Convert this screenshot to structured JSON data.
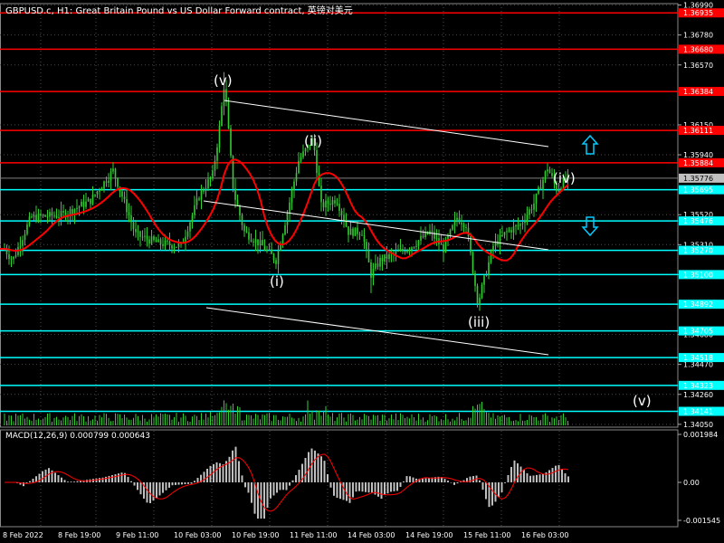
{
  "header": {
    "title": "GBPUSD.c, H1:  Great Britain Pound vs US Dollar Forward contract, 英镑对美元"
  },
  "macd": {
    "label": "MACD(12,26,9) 0.000799 0.000643",
    "axis_labels": [
      "0.001984",
      "0.00",
      "-0.001545"
    ]
  },
  "colors": {
    "background": "#000000",
    "grid": "#4a4a4a",
    "candle": "#33cc33",
    "volume": "#33cc33",
    "resistance": "#ff0000",
    "support": "#00ffff",
    "moving_average": "#ff0000",
    "trendline": "#ffffff",
    "current_price": "#808080",
    "macd_hist": "#c0c0c0",
    "macd_signal": "#ff0000",
    "arrow_up": "#00ccff",
    "arrow_down": "#00ccff"
  },
  "price_axis": {
    "ticks": [
      "1.36990",
      "1.36780",
      "1.36570",
      "1.36150",
      "1.35940",
      "1.35520",
      "1.35310",
      "1.35100",
      "1.34680",
      "1.34470",
      "1.34260",
      "1.34050"
    ]
  },
  "resistance_levels": [
    {
      "price": "1.36935"
    },
    {
      "price": "1.36680"
    },
    {
      "price": "1.36384"
    },
    {
      "price": "1.36111"
    },
    {
      "price": "1.35884"
    }
  ],
  "current_price": "1.35776",
  "support_levels": [
    {
      "price": "1.35695"
    },
    {
      "price": "1.35476"
    },
    {
      "price": "1.35270"
    },
    {
      "price": "1.35100"
    },
    {
      "price": "1.34892"
    },
    {
      "price": "1.34705"
    },
    {
      "price": "1.34518"
    },
    {
      "price": "1.34323"
    },
    {
      "price": "1.34141"
    }
  ],
  "wave_labels": [
    "(v)",
    "(ii)",
    "(i)",
    "(iii)",
    "(iv)",
    "(v)"
  ],
  "time_axis": [
    "8 Feb 2022",
    "8 Feb 19:00",
    "9 Feb 11:00",
    "10 Feb 03:00",
    "10 Feb 19:00",
    "11 Feb 11:00",
    "14 Feb 03:00",
    "14 Feb 19:00",
    "15 Feb 11:00",
    "16 Feb 03:00"
  ]
}
